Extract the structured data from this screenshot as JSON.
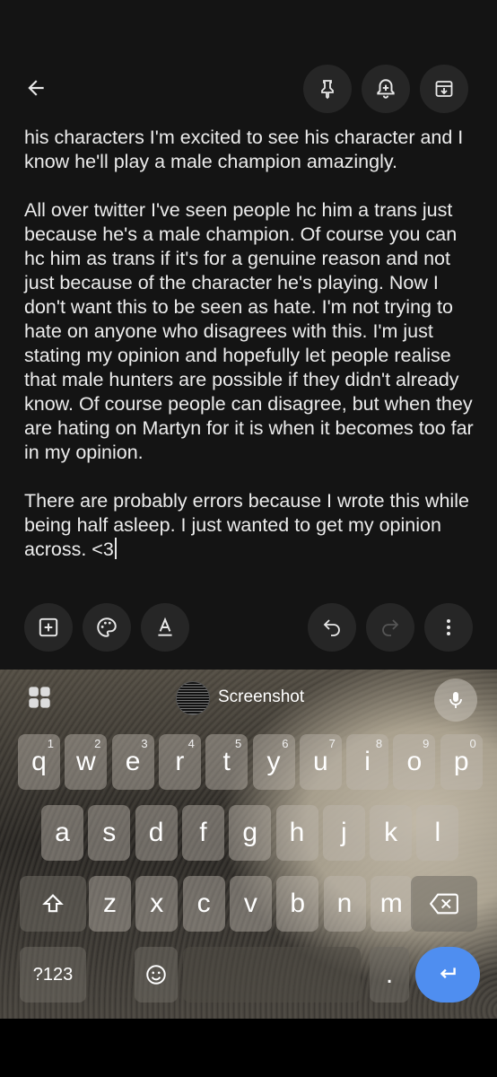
{
  "toolbar_top": {
    "back_icon": "arrow-left-icon",
    "pin_icon": "pin-icon",
    "reminder_icon": "bell-plus-icon",
    "archive_icon": "archive-icon"
  },
  "note": {
    "paragraphs": [
      "his characters I'm excited to see his character and I know he'll play a male champion amazingly.",
      "All over twitter I've seen people hc him a trans just because he's a male champion. Of course you can hc him as trans if it's for a genuine reason and not just because of the character he's playing. Now I don't want this to be seen as hate. I'm not trying to hate on anyone who disagrees with this. I'm just stating my opinion and hopefully let people realise that male hunters are possible if they didn't already know. Of course people can disagree, but when they are hating on Martyn for it is when it becomes too far in my opinion.",
      "There are probably errors because I wrote this while being half asleep. I just wanted to get my opinion across. <3"
    ]
  },
  "toolbar_bottom": {
    "add_icon": "add-box-icon",
    "palette_icon": "palette-icon",
    "text_format_icon": "text-format-icon",
    "undo_icon": "undo-icon",
    "redo_icon": "redo-icon",
    "more_icon": "more-vert-icon"
  },
  "keyboard": {
    "suggestion_label": "Screenshot",
    "row1": [
      {
        "k": "q",
        "h": "1"
      },
      {
        "k": "w",
        "h": "2"
      },
      {
        "k": "e",
        "h": "3"
      },
      {
        "k": "r",
        "h": "4"
      },
      {
        "k": "t",
        "h": "5"
      },
      {
        "k": "y",
        "h": "6"
      },
      {
        "k": "u",
        "h": "7"
      },
      {
        "k": "i",
        "h": "8"
      },
      {
        "k": "o",
        "h": "9"
      },
      {
        "k": "p",
        "h": "0"
      }
    ],
    "row2": [
      "a",
      "s",
      "d",
      "f",
      "g",
      "h",
      "j",
      "k",
      "l"
    ],
    "row3": [
      "z",
      "x",
      "c",
      "v",
      "b",
      "n",
      "m"
    ],
    "symbols_label": "?123",
    "period_label": "."
  }
}
